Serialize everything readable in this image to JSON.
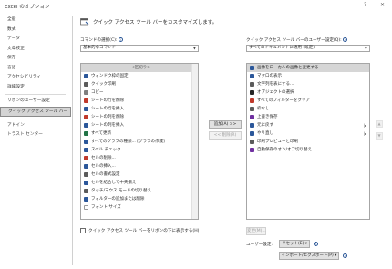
{
  "window": {
    "title": "Excel のオプション",
    "help": "?",
    "close": "✕"
  },
  "nav": {
    "items": [
      {
        "label": "全般",
        "selected": false
      },
      {
        "label": "数式",
        "selected": false
      },
      {
        "label": "データ",
        "selected": false
      },
      {
        "label": "文章校正",
        "selected": false
      },
      {
        "label": "保存",
        "selected": false
      },
      {
        "label": "言語",
        "selected": false
      },
      {
        "label": "アクセシビリティ",
        "selected": false
      },
      {
        "label": "詳細設定",
        "selected": false
      },
      {
        "label": "リボンのユーザー設定",
        "selected": false
      },
      {
        "label": "クイック アクセス ツール バー",
        "selected": true
      },
      {
        "label": "アドイン",
        "selected": false
      },
      {
        "label": "トラスト センター",
        "selected": false
      }
    ]
  },
  "header": {
    "text": "クイック アクセス ツール バーをカスタマイズします。"
  },
  "left": {
    "label": "コマンドの選択(C):",
    "combo_value": "基本的なコマンド",
    "items": [
      {
        "label": "<区切り>",
        "icon": "separator",
        "color": "#ffffff",
        "selected": true,
        "arrow": ""
      },
      {
        "label": "ウィンドウ枠の固定",
        "icon": "freeze-panes-icon",
        "color": "#2b579a",
        "selected": false,
        "arrow": "▸"
      },
      {
        "label": "クイック印刷",
        "icon": "quick-print-icon",
        "color": "#5b5b5b",
        "selected": false,
        "arrow": ""
      },
      {
        "label": "コピー",
        "icon": "copy-icon",
        "color": "#7f7f7f",
        "selected": false,
        "arrow": ""
      },
      {
        "label": "シートの行を削除",
        "icon": "delete-rows-icon",
        "color": "#c0392b",
        "selected": false,
        "arrow": ""
      },
      {
        "label": "シートの行を挿入",
        "icon": "insert-rows-icon",
        "color": "#2b579a",
        "selected": false,
        "arrow": ""
      },
      {
        "label": "シートの列を削除",
        "icon": "delete-columns-icon",
        "color": "#c0392b",
        "selected": false,
        "arrow": ""
      },
      {
        "label": "シートの列を挿入",
        "icon": "insert-columns-icon",
        "color": "#2b579a",
        "selected": false,
        "arrow": ""
      },
      {
        "label": "すべて更新",
        "icon": "refresh-all-icon",
        "color": "#217346",
        "selected": false,
        "arrow": ""
      },
      {
        "label": "すべてのグラフの種類... [グラフの作成]",
        "icon": "chart-types-icon",
        "color": "#2b579a",
        "selected": false,
        "arrow": ""
      },
      {
        "label": "スペル チェック...",
        "icon": "spell-check-icon",
        "color": "#2b579a",
        "selected": false,
        "arrow": ""
      },
      {
        "label": "セルの削除...",
        "icon": "delete-cells-icon",
        "color": "#c0392b",
        "selected": false,
        "arrow": ""
      },
      {
        "label": "セルの挿入...",
        "icon": "insert-cells-icon",
        "color": "#2b579a",
        "selected": false,
        "arrow": ""
      },
      {
        "label": "セルの書式設定",
        "icon": "format-cells-icon",
        "color": "#5b5b5b",
        "selected": false,
        "arrow": ""
      },
      {
        "label": "セルを結合して中央揃え",
        "icon": "merge-center-icon",
        "color": "#2b579a",
        "selected": false,
        "arrow": ""
      },
      {
        "label": "タッチ/マウス モードの切り替え",
        "icon": "touch-mode-icon",
        "color": "#5b5b5b",
        "selected": false,
        "arrow": "▸"
      },
      {
        "label": "フィルターの追加または削除",
        "icon": "filter-icon",
        "color": "#2b579a",
        "selected": false,
        "arrow": ""
      },
      {
        "label": "フォント サイズ",
        "icon": "font-size-icon",
        "color": "#ffffff",
        "selected": false,
        "arrow": ""
      }
    ]
  },
  "middle": {
    "add_label": "追加(A) >>",
    "remove_label": "<< 削除(R)"
  },
  "right": {
    "label": "クイック アクセス ツール バーのユーザー設定(Q):",
    "combo_value": "すべてのドキュメントに適用 (既定)",
    "items": [
      {
        "label": "画像をローカルの画像と変更する",
        "icon": "replace-image-icon",
        "color": "#2b579a",
        "selected": true,
        "arrow": ""
      },
      {
        "label": "マクロの表示",
        "icon": "macro-icon",
        "color": "#2b579a",
        "selected": false,
        "arrow": ""
      },
      {
        "label": "文字列を表にする...",
        "icon": "text-to-table-icon",
        "color": "#5b5b5b",
        "selected": false,
        "arrow": ""
      },
      {
        "label": "オブジェクトの選択",
        "icon": "select-objects-icon",
        "color": "#262626",
        "selected": false,
        "arrow": ""
      },
      {
        "label": "すべてのフィルターをクリア",
        "icon": "clear-filter-icon",
        "color": "#c0392b",
        "selected": false,
        "arrow": ""
      },
      {
        "label": "枠なし",
        "icon": "no-border-icon",
        "color": "#5b5b5b",
        "selected": false,
        "arrow": ""
      },
      {
        "label": "上書き保存",
        "icon": "save-icon",
        "color": "#7030a0",
        "selected": false,
        "arrow": ""
      },
      {
        "label": "元に戻す",
        "icon": "undo-icon",
        "color": "#2b579a",
        "selected": false,
        "arrow": "|▸"
      },
      {
        "label": "やり直し",
        "icon": "redo-icon",
        "color": "#2b579a",
        "selected": false,
        "arrow": "|▸"
      },
      {
        "label": "印刷プレビューと印刷",
        "icon": "print-preview-icon",
        "color": "#5b5b5b",
        "selected": false,
        "arrow": ""
      },
      {
        "label": "自動保存のオン/オフ切り替え",
        "icon": "autosave-icon",
        "color": "#7030a0",
        "selected": false,
        "arrow": ""
      }
    ]
  },
  "bottom": {
    "checkbox_label": "クイック アクセス ツール バーをリボンの下に表示する(H)",
    "modify_label": "変更(M)...",
    "user_settings_label": "ユーザー設定:",
    "reset_label": "リセット(E) ▾",
    "import_export_label": "インポート/エクスポート(P) ▾"
  }
}
